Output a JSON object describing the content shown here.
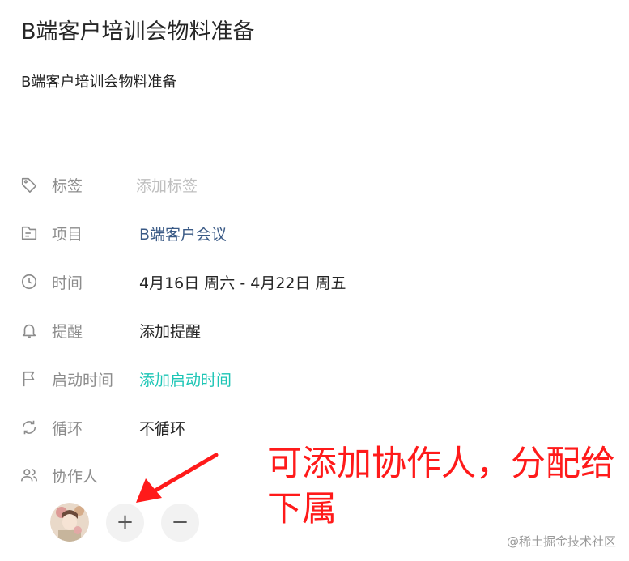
{
  "task": {
    "title": "B端客户培训会物料准备",
    "description": "B端客户培训会物料准备"
  },
  "fields": {
    "tags": {
      "label": "标签",
      "value": "添加标签",
      "icon": "tag-icon"
    },
    "project": {
      "label": "项目",
      "value": "B端客户会议",
      "icon": "folder-icon"
    },
    "time": {
      "label": "时间",
      "value": "4月16日 周六  -  4月22日 周五",
      "icon": "clock-icon"
    },
    "reminder": {
      "label": "提醒",
      "value": "添加提醒",
      "icon": "bell-icon"
    },
    "start_time": {
      "label": "启动时间",
      "value": "添加启动时间",
      "icon": "flag-icon"
    },
    "repeat": {
      "label": "循环",
      "value": "不循环",
      "icon": "repeat-icon"
    },
    "collaborators": {
      "label": "协作人",
      "icon": "users-icon",
      "add": "+",
      "remove": "−"
    }
  },
  "annotation": {
    "text": "可添加协作人，分配给下属",
    "color": "#ff1a1a"
  },
  "watermark": "@稀土掘金技术社区",
  "colors": {
    "accent": "#1cc5b5",
    "link": "#3a5a86",
    "muted": "#8c8c8c"
  }
}
